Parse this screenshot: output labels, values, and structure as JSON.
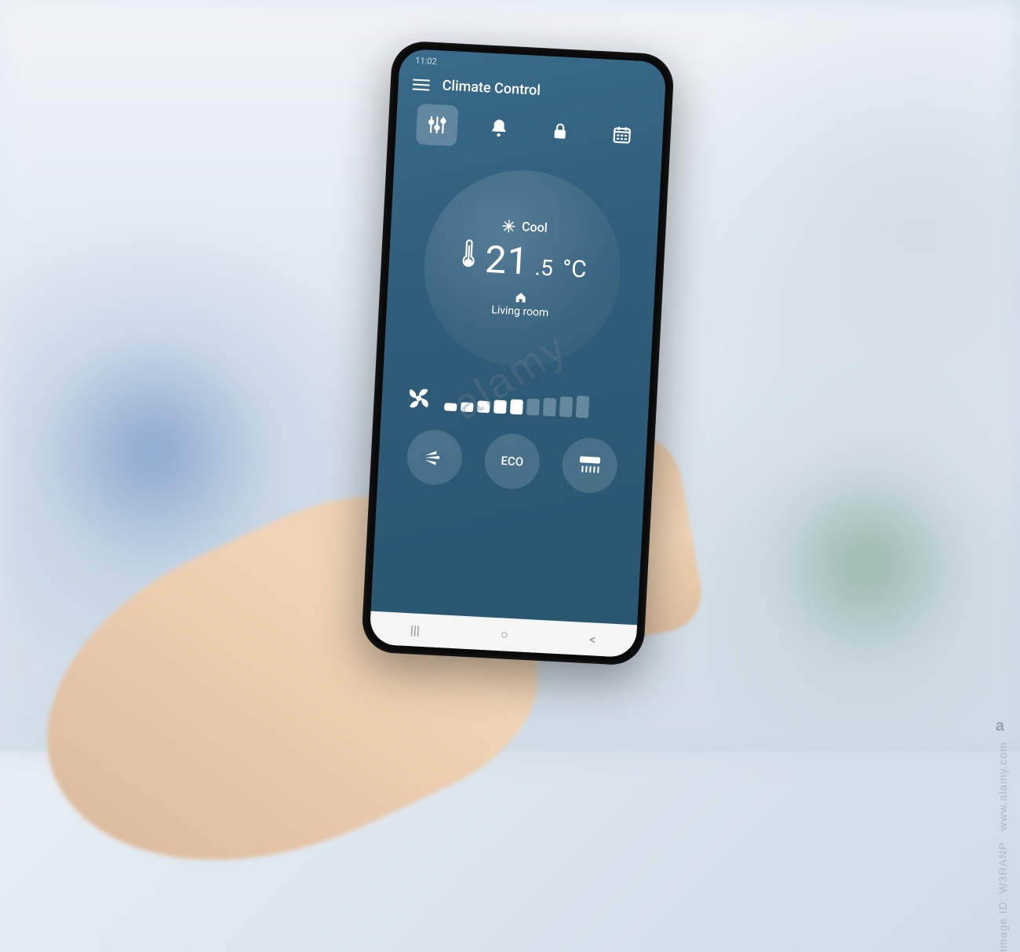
{
  "statusbar": {
    "time": "11:02"
  },
  "app": {
    "title": "Climate Control"
  },
  "tabs": {
    "settings": "settings",
    "alerts": "alerts",
    "lock": "lock",
    "schedule": "schedule"
  },
  "dial": {
    "mode_label": "Cool",
    "temperature_int": "21",
    "temperature_dec": ".5",
    "temperature_unit": "°C",
    "room_label": "Living room"
  },
  "fan": {
    "level": 5,
    "max": 9
  },
  "modes": {
    "swing": "swing",
    "eco_label": "ECO",
    "airflow": "airflow"
  },
  "watermark": {
    "brand": "alamy",
    "logo": "a",
    "image_id": "Image ID: W3RANP",
    "url": "www.alamy.com"
  }
}
